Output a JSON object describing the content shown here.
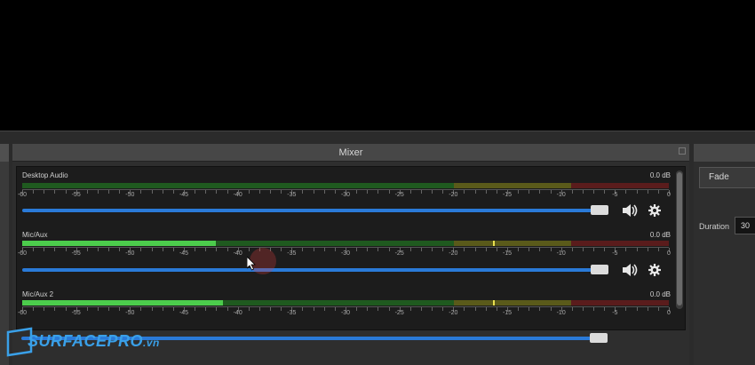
{
  "mixer": {
    "title": "Mixer",
    "scale_labels": [
      "-60",
      "-55",
      "-50",
      "-45",
      "-40",
      "-35",
      "-30",
      "-25",
      "-20",
      "-15",
      "-10",
      "-5",
      "0"
    ],
    "channels": [
      {
        "name": "Desktop Audio",
        "db": "0.0 dB",
        "level": 0.0,
        "volume": 1.0
      },
      {
        "name": "Mic/Aux",
        "db": "0.0 dB",
        "level": 0.3,
        "volume": 1.0
      },
      {
        "name": "Mic/Aux 2",
        "db": "0.0 dB",
        "level": 0.31,
        "volume": 1.0
      }
    ],
    "colors": {
      "green": "#4ccc4c",
      "yellow": "#e8e050",
      "red": "#c83232",
      "slider": "#2a7ad8"
    }
  },
  "transitions": {
    "selected": "Fade",
    "duration_label": "Duration",
    "duration_value": "30"
  },
  "icons": {
    "mute": "speaker-icon",
    "settings": "gear-icon"
  },
  "watermark": {
    "brand": "SURFACEPRO",
    "suffix": ".vn"
  }
}
